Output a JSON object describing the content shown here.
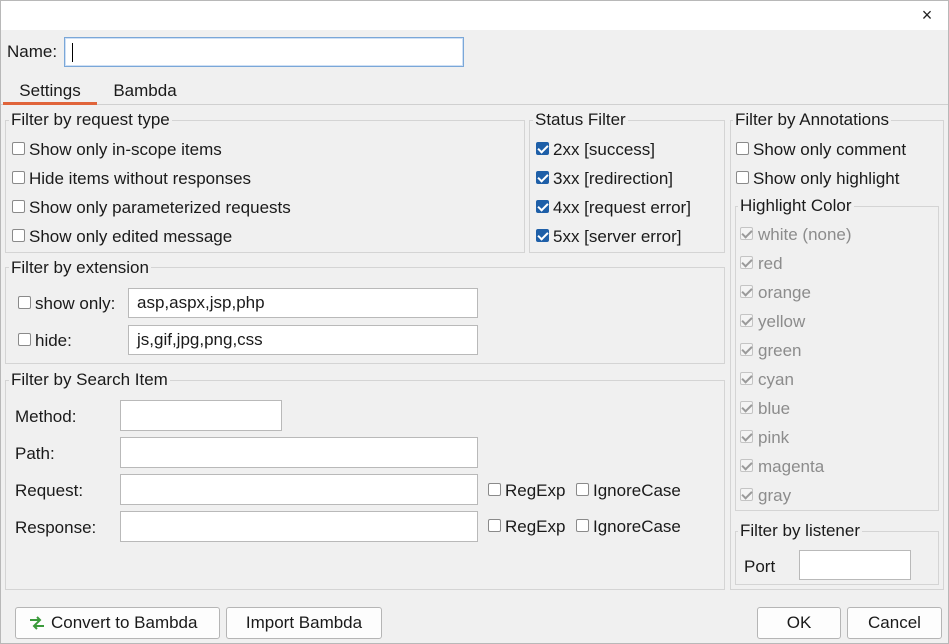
{
  "window": {
    "close_symbol": "×"
  },
  "name_label": "Name:",
  "name_value": "",
  "tabs": [
    {
      "label": "Settings",
      "active": true
    },
    {
      "label": "Bambda",
      "active": false
    }
  ],
  "request_type": {
    "title": "Filter by request type",
    "items": [
      {
        "label": "Show only in-scope items",
        "checked": false
      },
      {
        "label": "Hide items without responses",
        "checked": false
      },
      {
        "label": "Show only parameterized requests",
        "checked": false
      },
      {
        "label": "Show only edited message",
        "checked": false
      }
    ]
  },
  "status_filter": {
    "title": "Status Filter",
    "items": [
      {
        "label": "2xx [success]",
        "checked": true
      },
      {
        "label": "3xx [redirection]",
        "checked": true
      },
      {
        "label": "4xx [request error]",
        "checked": true
      },
      {
        "label": "5xx [server error]",
        "checked": true
      }
    ]
  },
  "annotations": {
    "title": "Filter by Annotations",
    "show_comment": "Show only comment",
    "show_highlight": "Show only highlight",
    "highlight_title": "Highlight Color",
    "colors": [
      "white (none)",
      "red",
      "orange",
      "yellow",
      "green",
      "cyan",
      "blue",
      "pink",
      "magenta",
      "gray"
    ]
  },
  "extension": {
    "title": "Filter by extension",
    "show_only_label": "show only:",
    "show_only_value": "asp,aspx,jsp,php",
    "hide_label": "hide:",
    "hide_value": "js,gif,jpg,png,css"
  },
  "search": {
    "title": "Filter by Search Item",
    "method_label": "Method:",
    "path_label": "Path:",
    "request_label": "Request:",
    "response_label": "Response:",
    "regexp_label": "RegExp",
    "ignorecase_label": "IgnoreCase"
  },
  "listener": {
    "title": "Filter by listener",
    "port_label": "Port",
    "port_value": ""
  },
  "buttons": {
    "convert": "Convert to Bambda",
    "import": "Import Bambda",
    "ok": "OK",
    "cancel": "Cancel"
  },
  "icons": {
    "convert": "convert-arrows-icon"
  },
  "colors": {
    "accent": "#e0643a",
    "checkbox_blue": "#1e5fa8"
  }
}
